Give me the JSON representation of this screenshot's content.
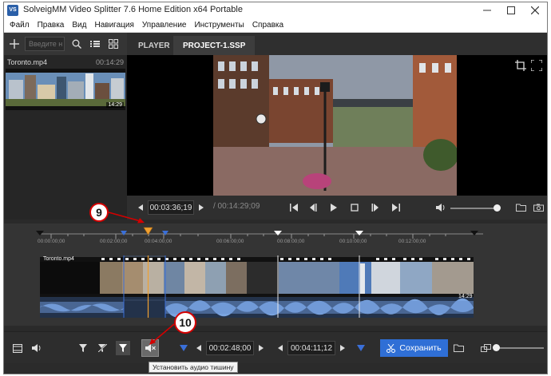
{
  "window": {
    "title": "SolveigMM Video Splitter 7.6 Home Edition x64 Portable",
    "app_icon_text": "VS"
  },
  "menu": [
    "Файл",
    "Правка",
    "Вид",
    "Навигация",
    "Управление",
    "Инструменты",
    "Справка"
  ],
  "search": {
    "placeholder": "Введите н"
  },
  "tabs": {
    "player": "PLAYER",
    "project": "PROJECT-1.SSP"
  },
  "media": {
    "name": "Toronto.mp4",
    "duration": "00:14:29",
    "thumb_duration": "14:29"
  },
  "playback": {
    "current_time": "00:03:36;19",
    "total_time": "/ 00:14:29;09"
  },
  "ruler": {
    "labels": [
      "00:00:00;00",
      "00:02:00;00",
      "00:04:00;00",
      "00:06:00;00",
      "00:08:00;00",
      "00:10:00;00",
      "00:12:00;00"
    ]
  },
  "track": {
    "name": "Toronto.mp4",
    "duration": "14:29"
  },
  "bottom": {
    "marker_in_time": "00:02:48;00",
    "marker_out_time": "00:04:11;12",
    "save_label": "Сохранить",
    "tooltip": "Установить аудио тишину"
  },
  "callouts": {
    "first": "9",
    "second": "10"
  },
  "colors": {
    "accent": "#2f6fd6",
    "marker": "#3a6fd8",
    "cursor": "#f0a030",
    "callout": "#d40000"
  }
}
